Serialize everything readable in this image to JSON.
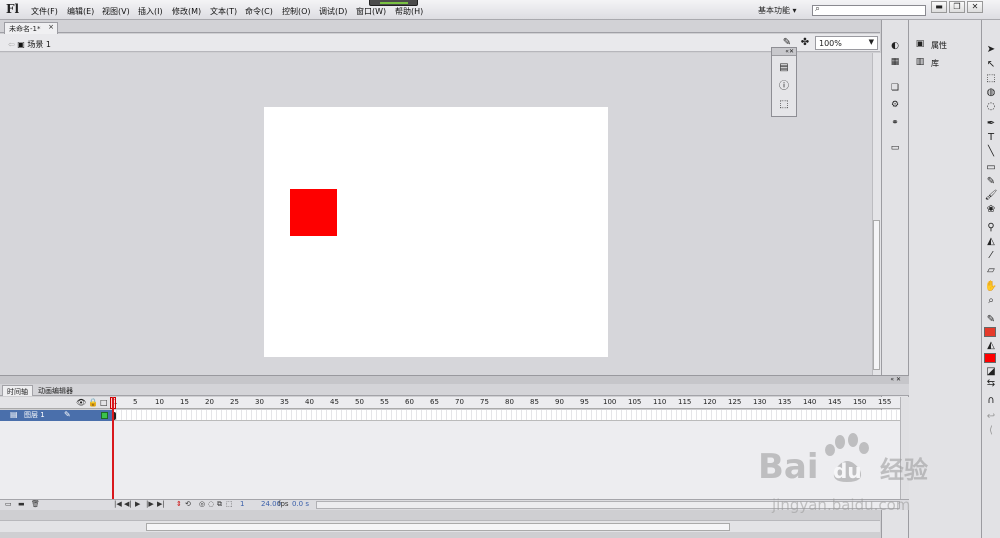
{
  "app": {
    "logo": "Fl"
  },
  "menu": [
    "文件(F)",
    "编辑(E)",
    "视图(V)",
    "插入(I)",
    "修改(M)",
    "文本(T)",
    "命令(C)",
    "控制(O)",
    "调试(D)",
    "窗口(W)",
    "帮助(H)"
  ],
  "workspace": {
    "label": "基本功能",
    "arrow": "▾"
  },
  "window_controls": {
    "minimize": "▬",
    "restore": "❐",
    "close": "✕"
  },
  "document": {
    "tab_title": "未命名-1*",
    "close_glyph": "×",
    "scene_label": "场景 1",
    "zoom": "100%"
  },
  "stage": {
    "background": "#ffffff",
    "shape_color": "#fe0000"
  },
  "panels": {
    "properties_label": "属性",
    "library_label": "库"
  },
  "timeline": {
    "tabs": [
      "时间轴",
      "动画编辑器"
    ],
    "layer_name": "图层 1",
    "ruler_ticks": [
      "1",
      "5",
      "10",
      "15",
      "20",
      "25",
      "30",
      "35",
      "40",
      "45",
      "50",
      "55",
      "60",
      "65",
      "70",
      "75",
      "80",
      "85",
      "90",
      "95",
      "100",
      "105",
      "110",
      "115",
      "120",
      "125",
      "130",
      "135",
      "140",
      "145",
      "150",
      "155"
    ],
    "current_frame": "1",
    "fps": "24.00",
    "fps_unit": "fps",
    "time": "0.0 s"
  },
  "watermark": {
    "brand": "Bai",
    "brand2": "du",
    "brand_cn": "经验",
    "url": "jingyan.baidu.com"
  },
  "colors": {
    "accent_layer": "#4a6fab",
    "stroke_swatch": "#e53a2a",
    "fill_swatch": "#fe0000",
    "playhead": "#d9181d"
  }
}
